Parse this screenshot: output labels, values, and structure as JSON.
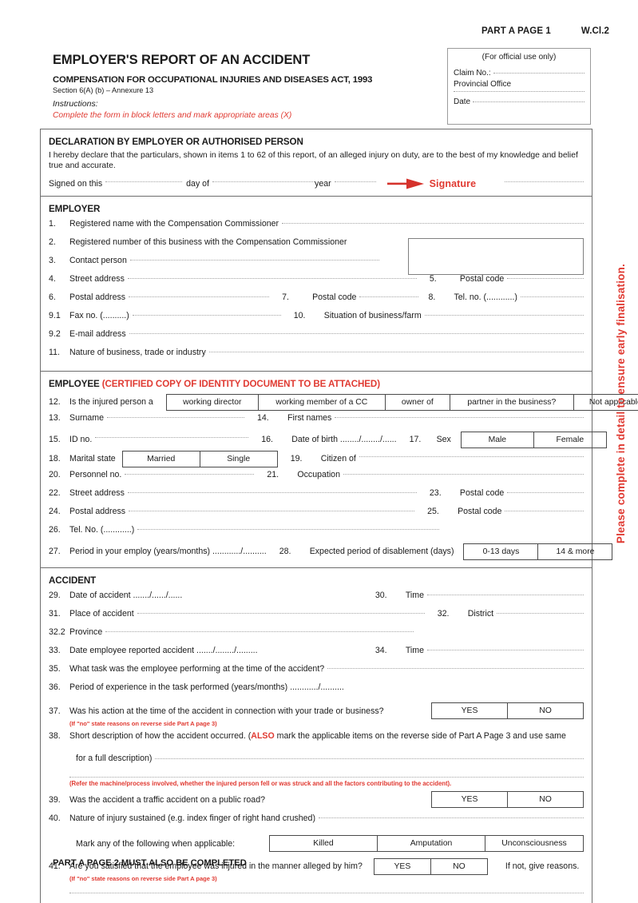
{
  "header": {
    "part_page": "PART A PAGE 1",
    "form_code": "W.Cl.2",
    "title": "EMPLOYER'S REPORT OF AN ACCIDENT",
    "act": "COMPENSATION FOR OCCUPATIONAL INJURIES AND DISEASES ACT, 1993",
    "section_ref": "Section 6(A) (b) – Annexure 13",
    "instructions_label": "Instructions:",
    "instructions_text": "Complete the form in block letters and mark appropriate areas (X)"
  },
  "official_box": {
    "heading": "(For official use only)",
    "claim_no_label": "Claim No.:",
    "provincial_office_label": "Provincial Office",
    "date_label": "Date"
  },
  "declaration": {
    "heading": "DECLARATION BY EMPLOYER OR AUTHORISED PERSON",
    "body": "I hereby declare that the particulars, shown in items 1 to 62 of this report, of an alleged injury on duty, are to the best of my knowledge and belief true and accurate.",
    "signed_on_this": "Signed on this",
    "day_of": "day of",
    "year": "year",
    "signature_label": "Signature"
  },
  "employer": {
    "heading": "EMPLOYER",
    "items": [
      {
        "num": "1.",
        "label": "Registered name with the Compensation Commissioner"
      },
      {
        "num": "2.",
        "label": "Registered number of this business with the Compensation Commissioner"
      },
      {
        "num": "3.",
        "label": "Contact person"
      },
      {
        "num": "4.",
        "label": "Street address"
      },
      {
        "num": "5.",
        "label": "Postal code"
      },
      {
        "num": "6.",
        "label": "Postal address"
      },
      {
        "num": "7.",
        "label": "Postal code"
      },
      {
        "num": "8.",
        "label": "Tel. no. (............)"
      },
      {
        "num": "9.1",
        "label": "Fax no. (..........)"
      },
      {
        "num": "10.",
        "label": "Situation of business/farm"
      },
      {
        "num": "9.2",
        "label": "E-mail address"
      },
      {
        "num": "11.",
        "label": "Nature of business, trade or industry"
      }
    ]
  },
  "employee": {
    "heading": "EMPLOYEE",
    "heading_note": "(CERTIFIED COPY OF IDENTITY DOCUMENT TO BE ATTACHED)",
    "items": [
      {
        "num": "12.",
        "label": "Is the injured person a"
      },
      {
        "num": "13.",
        "label": "Surname"
      },
      {
        "num": "14.",
        "label": "First names"
      },
      {
        "num": "15.",
        "label": "ID no."
      },
      {
        "num": "16.",
        "label": "Date of birth ......../......../......"
      },
      {
        "num": "17.",
        "label": "Sex"
      },
      {
        "num": "18.",
        "label": "Marital state"
      },
      {
        "num": "19.",
        "label": "Citizen of"
      },
      {
        "num": "20.",
        "label": "Personnel no."
      },
      {
        "num": "21.",
        "label": "Occupation"
      },
      {
        "num": "22.",
        "label": "Street address"
      },
      {
        "num": "23.",
        "label": "Postal code"
      },
      {
        "num": "24.",
        "label": "Postal address"
      },
      {
        "num": "25.",
        "label": "Postal code"
      },
      {
        "num": "26.",
        "label": "Tel. No. (............)"
      },
      {
        "num": "27.",
        "label": "Period in your employ (years/months) ............/.........."
      },
      {
        "num": "28.",
        "label": "Expected period of disablement (days)"
      }
    ],
    "person_options": [
      "working director",
      "working member of a CC",
      "owner of",
      "partner in the business?",
      "Not applicable"
    ],
    "sex_options": [
      "Male",
      "Female"
    ],
    "marital_options": [
      "Married",
      "Single"
    ],
    "disablement_options": [
      "0-13 days",
      "14 & more"
    ]
  },
  "accident": {
    "heading": "ACCIDENT",
    "items": [
      {
        "num": "29.",
        "label": "Date of accident ......./....../......"
      },
      {
        "num": "30.",
        "label": "Time"
      },
      {
        "num": "31.",
        "label": "Place of accident"
      },
      {
        "num": "32.",
        "label": "District"
      },
      {
        "num": "32.2",
        "label": "Province"
      },
      {
        "num": "33.",
        "label": "Date employee reported accident ......./......../........."
      },
      {
        "num": "34.",
        "label": "Time"
      },
      {
        "num": "35.",
        "label": "What task was the employee performing at the time of the accident?"
      },
      {
        "num": "36.",
        "label": "Period of experience in the task performed (years/months) ............/.........."
      },
      {
        "num": "37.",
        "label": "Was his action at the time of the accident in connection with your trade or business?"
      },
      {
        "num": "38.",
        "label_part1": "Short description of how the accident occurred. (",
        "label_also": "ALSO",
        "label_part2": " mark the applicable items on the reverse side of Part A Page 3 and use same"
      },
      {
        "num": "39.",
        "label": "Was the accident a traffic accident on a public road?"
      },
      {
        "num": "40.",
        "label": "Nature of injury sustained (e.g. index finger of right hand crushed)"
      },
      {
        "num": "41.",
        "label": "Are you satisfied that the employee was injured in the manner alleged by him?"
      }
    ],
    "note_37": "(If \"no\" state reasons on reverse side Part A page 3)",
    "item38_continuation": "for a full description)",
    "note_38": "(Refer the machine/process involved, whether the injured person fell or was struck and all the factors contributing to the accident).",
    "mark_applicable_label": "Mark any of the following when applicable:",
    "injury_options": [
      "Killed",
      "Amputation",
      "Unconsciousness"
    ],
    "yes_no": [
      "YES",
      "NO"
    ],
    "if_not_give_reasons": "If not, give reasons.",
    "note_41": "(If \"no\" state reasons on reverse side Part A page 3)"
  },
  "side_note": "Please complete in detail to ensure early finalisation.",
  "footer": "PART A PAGE 2 MUST ALSO BE COMPLETED",
  "colors": {
    "red": "#e03a32",
    "frame": "#6d6d6d",
    "dots": "#a3a3a3"
  }
}
